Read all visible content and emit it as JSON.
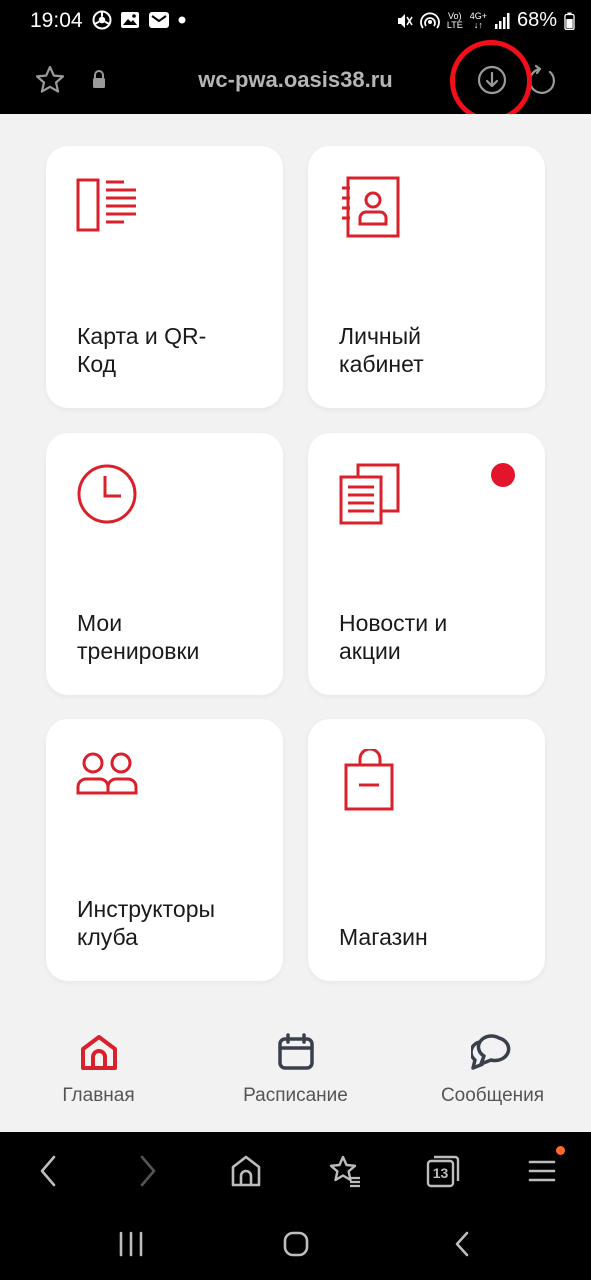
{
  "status_bar": {
    "time": "19:04",
    "network_top": "Vo)",
    "network_bottom": "LTE",
    "network_type": "4G+",
    "battery": "68%"
  },
  "browser": {
    "url": "wc-pwa.oasis38.ru",
    "tab_count": "13"
  },
  "tiles": [
    {
      "label": "Карта и QR-\nКод",
      "icon": "id-card-list-icon"
    },
    {
      "label": "Личный\nкабинет",
      "icon": "profile-book-icon"
    },
    {
      "label": "Мои\nтренировки",
      "icon": "clock-icon"
    },
    {
      "label": "Новости и\nакции",
      "icon": "news-icon",
      "badge": true
    },
    {
      "label": "Инструкторы\nклуба",
      "icon": "users-icon"
    },
    {
      "label": "Магазин",
      "icon": "shopping-bag-icon"
    }
  ],
  "tabbar": {
    "home": "Главная",
    "schedule": "Расписание",
    "messages": "Сообщения"
  },
  "colors": {
    "accent": "#d9202b",
    "annotation": "#f20f1a"
  }
}
